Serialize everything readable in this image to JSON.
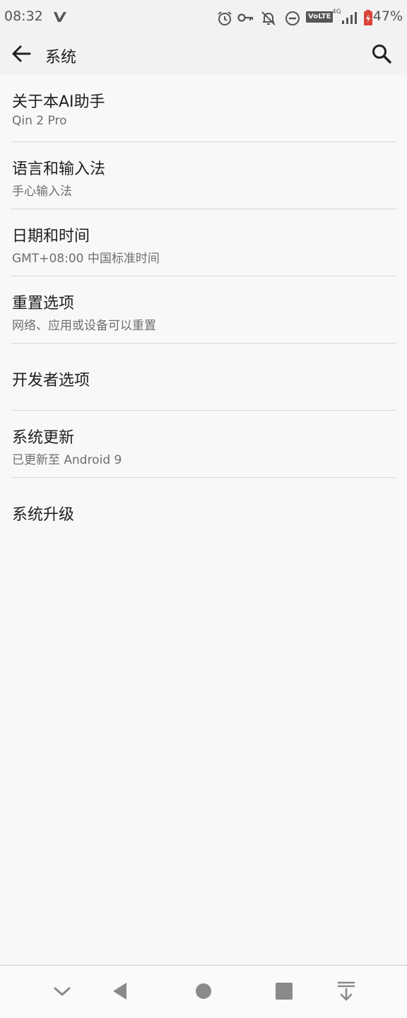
{
  "status_bar": {
    "time": "08:32",
    "battery_percent": "47%",
    "icons": [
      "v-icon",
      "alarm-icon",
      "vpn-key-icon",
      "notifications-off-icon",
      "do-not-disturb-icon",
      "volte-icon",
      "network-4g-icon",
      "signal-icon",
      "battery-icon"
    ],
    "volte_label": "VoLTE",
    "network_label": "4G"
  },
  "app_bar": {
    "title": "系统"
  },
  "settings": [
    {
      "title": "关于本AI助手",
      "subtitle": "Qin 2 Pro"
    },
    {
      "title": "语言和输入法",
      "subtitle": "手心输入法"
    },
    {
      "title": "日期和时间",
      "subtitle": "GMT+08:00 中国标准时间"
    },
    {
      "title": "重置选项",
      "subtitle": "网络、应用或设备可以重置"
    },
    {
      "title": "开发者选项"
    },
    {
      "title": "系统更新",
      "subtitle": "已更新至 Android 9"
    },
    {
      "title": "系统升级"
    }
  ],
  "nav_bar": {
    "icons": [
      "chevron-down-icon",
      "back-triangle-icon",
      "home-circle-icon",
      "recents-square-icon",
      "pull-down-icon"
    ]
  },
  "colors": {
    "background": "#f8f8f8",
    "bar": "#f2f2f2",
    "text_primary": "#202020",
    "text_secondary": "#6e6e6e",
    "nav_icon": "#8a8a8a",
    "battery_red": "#d9453b"
  }
}
